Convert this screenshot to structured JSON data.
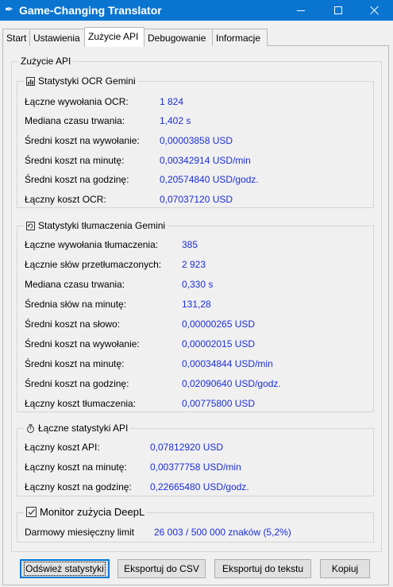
{
  "window": {
    "title": "Game-Changing Translator"
  },
  "tabs": [
    "Start",
    "Ustawienia",
    "Zużycie API",
    "Debugowanie",
    "Informacje"
  ],
  "panel": {
    "title": "Zużycie API"
  },
  "ocr": {
    "title": "Statystyki OCR Gemini",
    "rows": [
      {
        "label": "Łączne wywołania OCR:",
        "value": "1 824"
      },
      {
        "label": "Mediana czasu trwania:",
        "value": "1,402 s"
      },
      {
        "label": "Średni koszt na wywołanie:",
        "value": "0,00003858 USD"
      },
      {
        "label": "Średni koszt na minutę:",
        "value": "0,00342914 USD/min"
      },
      {
        "label": "Średni koszt na godzinę:",
        "value": "0,20574840 USD/godz."
      },
      {
        "label": "Łączny koszt OCR:",
        "value": "0,07037120 USD"
      }
    ]
  },
  "translation": {
    "title": "Statystyki tłumaczenia Gemini",
    "rows": [
      {
        "label": "Łączne wywołania tłumaczenia:",
        "value": "385"
      },
      {
        "label": "Łącznie słów przetłumaczonych:",
        "value": "2 923"
      },
      {
        "label": "Mediana czasu trwania:",
        "value": "0,330 s"
      },
      {
        "label": "Średnia słów na minutę:",
        "value": "131,28"
      },
      {
        "label": "Średni koszt na słowo:",
        "value": "0,00000265 USD"
      },
      {
        "label": "Średni koszt na wywołanie:",
        "value": "0,00002015 USD"
      },
      {
        "label": "Średni koszt na minutę:",
        "value": "0,00034844 USD/min"
      },
      {
        "label": "Średni koszt na godzinę:",
        "value": "0,02090640 USD/godz."
      },
      {
        "label": "Łączny koszt tłumaczenia:",
        "value": "0,00775800 USD"
      }
    ]
  },
  "total": {
    "title": "Łączne statystyki API",
    "rows": [
      {
        "label": "Łączny koszt API:",
        "value": "0,07812920 USD"
      },
      {
        "label": "Łączny koszt na minutę:",
        "value": "0,00377758 USD/min"
      },
      {
        "label": "Łączny koszt na godzinę:",
        "value": "0,22665480 USD/godz."
      }
    ]
  },
  "deepl": {
    "title": "Monitor zużycia DeepL",
    "label": "Darmowy miesięczny limit",
    "value": "26 003 / 500 000 znaków (5,2%)"
  },
  "buttons": {
    "refresh": "Odśwież statystyki",
    "export_csv": "Eksportuj do CSV",
    "export_text": "Eksportuj do tekstu",
    "copy": "Kopiuj"
  },
  "colors": {
    "titlebar": "#0a75d1",
    "value_text": "#1c2ed8"
  },
  "icons": {
    "app": "feather-icon",
    "ocr": "bar-chart-icon",
    "translation": "refresh-icon",
    "total": "stopwatch-icon",
    "deepl": "checkbox-icon"
  }
}
